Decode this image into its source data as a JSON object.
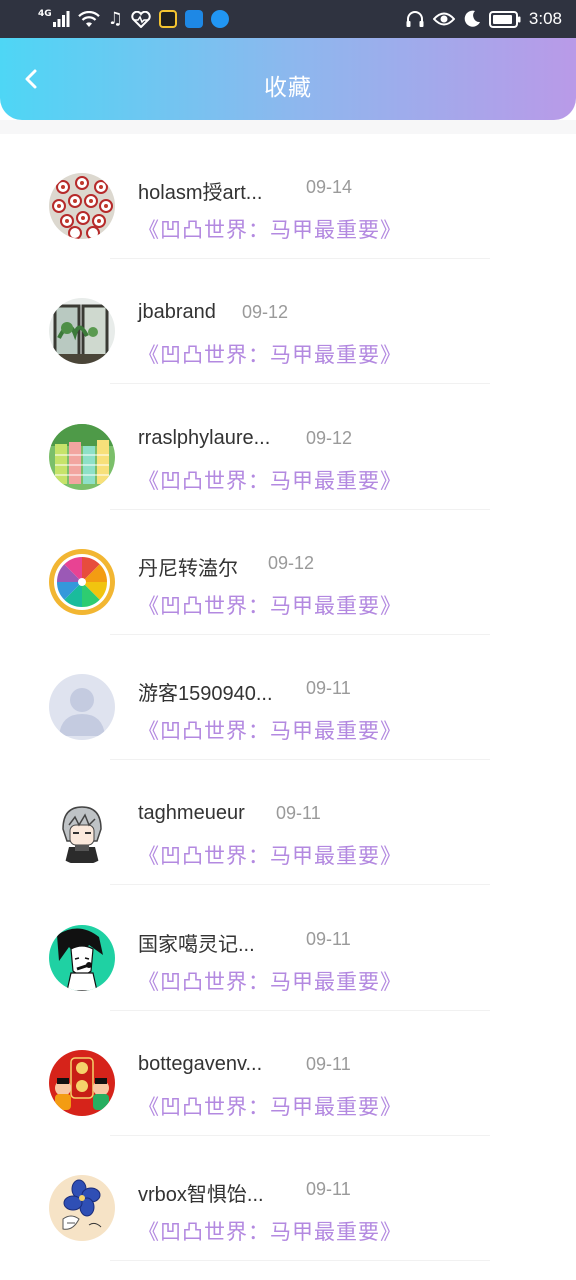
{
  "status_bar": {
    "network_label": "4G",
    "time": "3:08",
    "icons": [
      "signal-icon",
      "wifi-icon",
      "music-note-icon",
      "heart-pulse-icon",
      "app-icon",
      "app-icon",
      "app-icon",
      "headphones-icon",
      "eye-icon",
      "moon-icon",
      "battery-icon"
    ]
  },
  "header": {
    "title": "收藏",
    "back_icon": "chevron-left-icon",
    "gradient": [
      "#4ed6f5",
      "#b99ae8"
    ]
  },
  "colors": {
    "book_title": "#b389e0",
    "name": "#333333",
    "date": "#9a9a9a"
  },
  "items": [
    {
      "name": "holasm授art...",
      "date": "09-14",
      "book": "《凹凸世界：马甲最重要》",
      "avatar": "flower-pattern-avatar"
    },
    {
      "name": "jbabrand",
      "date": "09-12",
      "book": "《凹凸世界：马甲最重要》",
      "avatar": "window-plant-avatar"
    },
    {
      "name": "rraslphylaure...",
      "date": "09-12",
      "book": "《凹凸世界：马甲最重要》",
      "avatar": "colorful-garden-avatar"
    },
    {
      "name": "丹尼转溘尔",
      "date": "09-12",
      "book": "《凹凸世界：马甲最重要》",
      "avatar": "citrus-wheel-avatar"
    },
    {
      "name": "游客1590940...",
      "date": "09-11",
      "book": "《凹凸世界：马甲最重要》",
      "avatar": "default-user-avatar"
    },
    {
      "name": "taghmeueur",
      "date": "09-11",
      "book": "《凹凸世界：马甲最重要》",
      "avatar": "anime-boy-avatar"
    },
    {
      "name": "国家噶灵记...",
      "date": "09-11",
      "book": "《凹凸世界：马甲最重要》",
      "avatar": "anime-character-avatar"
    },
    {
      "name": "bottegavenv...",
      "date": "09-11",
      "book": "《凹凸世界：马甲最重要》",
      "avatar": "new-year-avatar"
    },
    {
      "name": "vrbox智惧饴...",
      "date": "09-11",
      "book": "《凹凸世界：马甲最重要》",
      "avatar": "blue-flower-avatar"
    }
  ]
}
